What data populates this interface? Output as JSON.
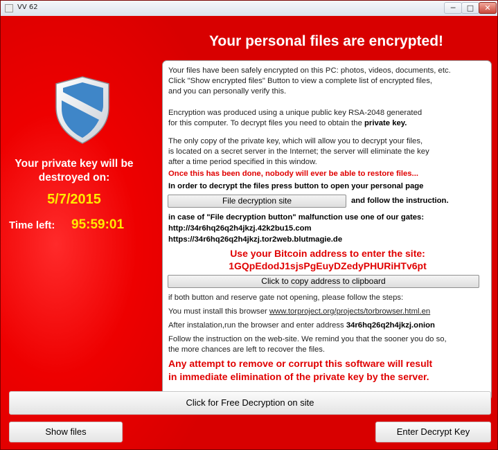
{
  "window": {
    "title": "VV 62",
    "minimize": "─",
    "maximize": "□",
    "close": "✕"
  },
  "header": {
    "headline": "Your personal files are encrypted!"
  },
  "left": {
    "shield_icon": "shield-icon",
    "destroy_label": "Your private key will be destroyed on:",
    "destroy_date": "5/7/2015",
    "time_left_label": "Time left:",
    "time_left_value": "95:59:01"
  },
  "panel": {
    "p1": "Your files have been safely encrypted on this PC: photos, videos, documents, etc.\nClick \"Show encrypted files\" Button to view a complete list of encrypted files,\nand you can personally verify this.",
    "p2_text": "Encryption was produced using a unique public key RSA-2048 generated\nfor this computer. To decrypt files you need to obtain the ",
    "p2_bold": "private key.",
    "p3": "The only copy of the private key, which will allow you to decrypt your files,\nis located on a secret server in the Internet; the server will eliminate the key\nafter a time period specified in this window.",
    "warning": "Once this has been done, nobody will ever be able to restore files...",
    "order_text": "In order to decrypt the files press button to open your personal page",
    "decrypt_site_button": "File decryption site",
    "follow_text": "and follow the instruction.",
    "gates_title": "in case of \"File decryption button\" malfunction use one of our gates:",
    "gate1": "http://34r6hq26q2h4jkzj.42k2bu15.com",
    "gate2": "https://34r6hq26q2h4jkzj.tor2web.blutmagie.de",
    "bitcoin_label": "Use your Bitcoin address to  enter the site:",
    "bitcoin_address": "1GQpEdodJ1sjsPgEuyDZedyPHURiHTv6pt",
    "copy_button": "Click to copy address to clipboard",
    "steps_intro": "if both button and reserve gate not opening, please follow the steps:",
    "install_text": "You must install this browser ",
    "install_link": "www.torproject.org/projects/torbrowser.html.en",
    "after_text": "After instalation,run the browser and enter address ",
    "onion_address": "34r6hq26q2h4jkzj.onion",
    "follow_web": "Follow the instruction on the web-site. We remind you that the sooner you do so,\nthe more chances are left to recover the files.",
    "final_warning": "Any attempt to remove or corrupt this software will result\nin immediate elimination of the private key by the server."
  },
  "buttons": {
    "free_decryption": "Click for Free Decryption on site",
    "show_files": "Show files",
    "enter_key": "Enter Decrypt Key"
  }
}
